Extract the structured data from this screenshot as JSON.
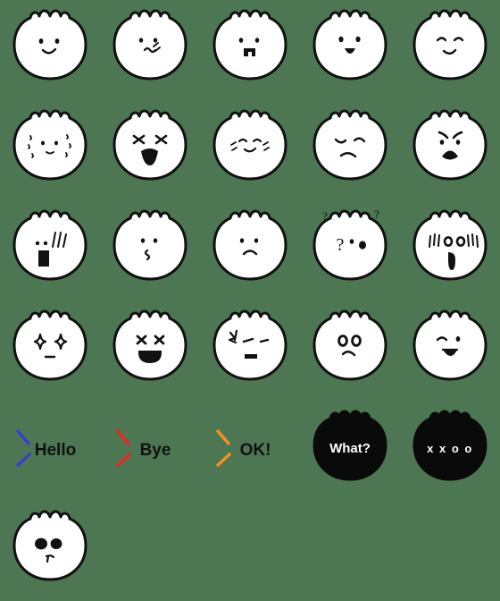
{
  "sheet": {
    "title": "Emoji sticker sheet",
    "background_color": "#4d7752",
    "columns": 5,
    "rows": 6,
    "cell_size": 112,
    "total_stickers": 26,
    "line_color": "#111111",
    "body_color": "#ffffff"
  },
  "palette": {
    "green_background": "#4d7752",
    "ink_black": "#111111",
    "blob_black": "#0a0a0a",
    "white": "#ffffff",
    "hello_blue": "#3a3ad6",
    "bye_red": "#f0281e",
    "ok_orange": "#f5921e"
  },
  "stickers": [
    {
      "index": 1,
      "row": 1,
      "col": 1,
      "kind": "face-white",
      "name": "smiling-face",
      "label": "smile",
      "text": ""
    },
    {
      "index": 2,
      "row": 1,
      "col": 2,
      "kind": "face-white",
      "name": "awkward-squiggle-face",
      "label": "awkward",
      "text": ""
    },
    {
      "index": 3,
      "row": 1,
      "col": 3,
      "kind": "face-white",
      "name": "tooth-grin-face",
      "label": "tooth grin",
      "text": ""
    },
    {
      "index": 4,
      "row": 1,
      "col": 4,
      "kind": "face-white",
      "name": "open-smile-face",
      "label": "happy open mouth",
      "text": ""
    },
    {
      "index": 5,
      "row": 1,
      "col": 5,
      "kind": "face-white",
      "name": "content-closed-eye-face",
      "label": "content",
      "text": ""
    },
    {
      "index": 6,
      "row": 2,
      "col": 1,
      "kind": "face-white",
      "name": "nervous-sweat-face",
      "label": "nervous sweat",
      "text": ""
    },
    {
      "index": 7,
      "row": 2,
      "col": 2,
      "kind": "face-white",
      "name": "crying-wail-face",
      "label": "crying",
      "text": ""
    },
    {
      "index": 8,
      "row": 2,
      "col": 3,
      "kind": "face-white",
      "name": "blushing-smile-face",
      "label": "blushing smile",
      "text": ""
    },
    {
      "index": 9,
      "row": 2,
      "col": 4,
      "kind": "face-white",
      "name": "sad-tired-face",
      "label": "sad tired",
      "text": ""
    },
    {
      "index": 10,
      "row": 2,
      "col": 5,
      "kind": "face-white",
      "name": "frowning-worried-face",
      "label": "worried",
      "text": ""
    },
    {
      "index": 11,
      "row": 3,
      "col": 1,
      "kind": "face-white",
      "name": "shouting-face",
      "label": "shouting",
      "text": ""
    },
    {
      "index": 12,
      "row": 3,
      "col": 2,
      "kind": "face-white",
      "name": "whistling-face",
      "label": "whistling",
      "text": ""
    },
    {
      "index": 13,
      "row": 3,
      "col": 3,
      "kind": "face-white",
      "name": "pouting-face",
      "label": "pouting",
      "text": ""
    },
    {
      "index": 14,
      "row": 3,
      "col": 4,
      "kind": "face-white",
      "name": "confused-question-face",
      "label": "confused",
      "text": "?"
    },
    {
      "index": 15,
      "row": 3,
      "col": 5,
      "kind": "face-white",
      "name": "surprised-shock-face",
      "label": "surprised",
      "text": ""
    },
    {
      "index": 16,
      "row": 4,
      "col": 1,
      "kind": "face-white",
      "name": "sparkle-eyes-face",
      "label": "sparkling eyes",
      "text": ""
    },
    {
      "index": 17,
      "row": 4,
      "col": 2,
      "kind": "face-white",
      "name": "dead-x-eyes-face",
      "label": "dead x eyes",
      "text": ""
    },
    {
      "index": 18,
      "row": 4,
      "col": 3,
      "kind": "face-white",
      "name": "annoyed-vein-face",
      "label": "annoyed",
      "text": ""
    },
    {
      "index": 19,
      "row": 4,
      "col": 4,
      "kind": "face-white",
      "name": "uneasy-big-eyes-face",
      "label": "uneasy",
      "text": ""
    },
    {
      "index": 20,
      "row": 4,
      "col": 5,
      "kind": "face-white",
      "name": "winking-grin-face",
      "label": "wink",
      "text": ""
    },
    {
      "index": 21,
      "row": 5,
      "col": 1,
      "kind": "text-slash",
      "name": "hello-text-sticker",
      "label": "hello",
      "text": "Hello",
      "accent": "#3a3ad6"
    },
    {
      "index": 22,
      "row": 5,
      "col": 2,
      "kind": "text-slash",
      "name": "bye-text-sticker",
      "label": "bye",
      "text": "Bye",
      "accent": "#f0281e"
    },
    {
      "index": 23,
      "row": 5,
      "col": 3,
      "kind": "text-slash",
      "name": "ok-text-sticker",
      "label": "ok",
      "text": "OK!",
      "accent": "#f5921e"
    },
    {
      "index": 24,
      "row": 5,
      "col": 4,
      "kind": "blob-black",
      "name": "what-blob-sticker",
      "label": "what",
      "text": "What?"
    },
    {
      "index": 25,
      "row": 5,
      "col": 5,
      "kind": "blob-black",
      "name": "xxoo-blob-sticker",
      "label": "xxoo",
      "text": "x x o o"
    },
    {
      "index": 26,
      "row": 6,
      "col": 1,
      "kind": "face-white",
      "name": "big-eyes-tiny-mouth-face",
      "label": "big eyes",
      "text": ""
    }
  ]
}
